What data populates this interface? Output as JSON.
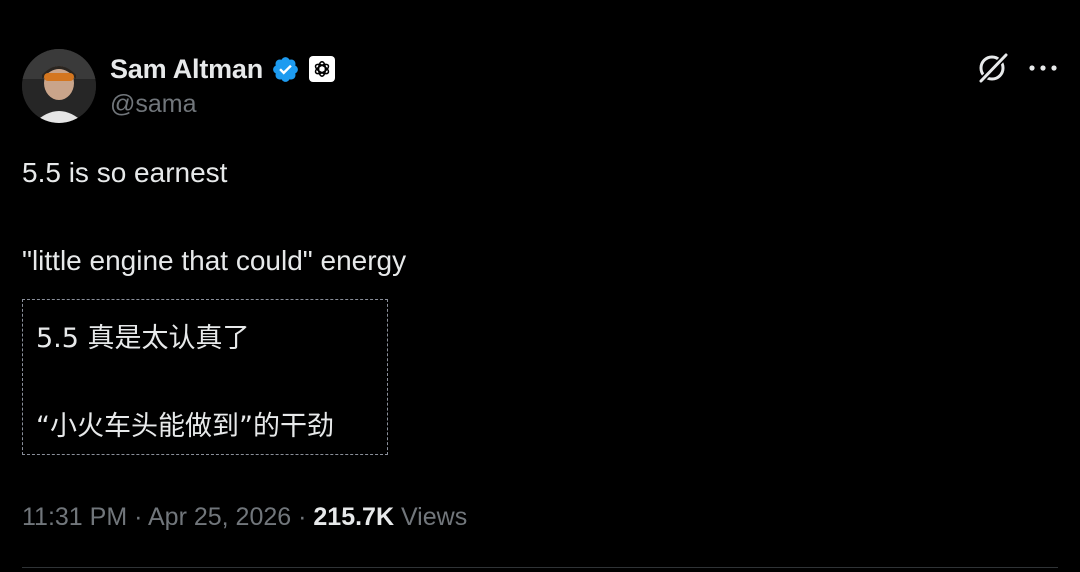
{
  "author": {
    "display_name": "Sam Altman",
    "handle": "@sama",
    "verified_icon": "verified-badge-icon",
    "affiliation_icon": "openai-logo-icon"
  },
  "actions": {
    "grok_icon": "grok-icon",
    "more_icon": "more-dots-icon"
  },
  "tweet": {
    "line1": "5.5 is so earnest",
    "line2": "\"little engine that could\" energy"
  },
  "translation": {
    "line1": "5.5 真是太认真了",
    "line2": "“小火车头能做到”的干劲"
  },
  "meta": {
    "time": "11:31 PM",
    "separator1": " · ",
    "date": "Apr 25, 2026",
    "separator2": " · ",
    "views_count": "215.7K",
    "views_label": " Views"
  },
  "colors": {
    "background": "#000000",
    "text": "#e7e9ea",
    "secondary_text": "#71767b",
    "verified_blue": "#1d9bf0"
  }
}
